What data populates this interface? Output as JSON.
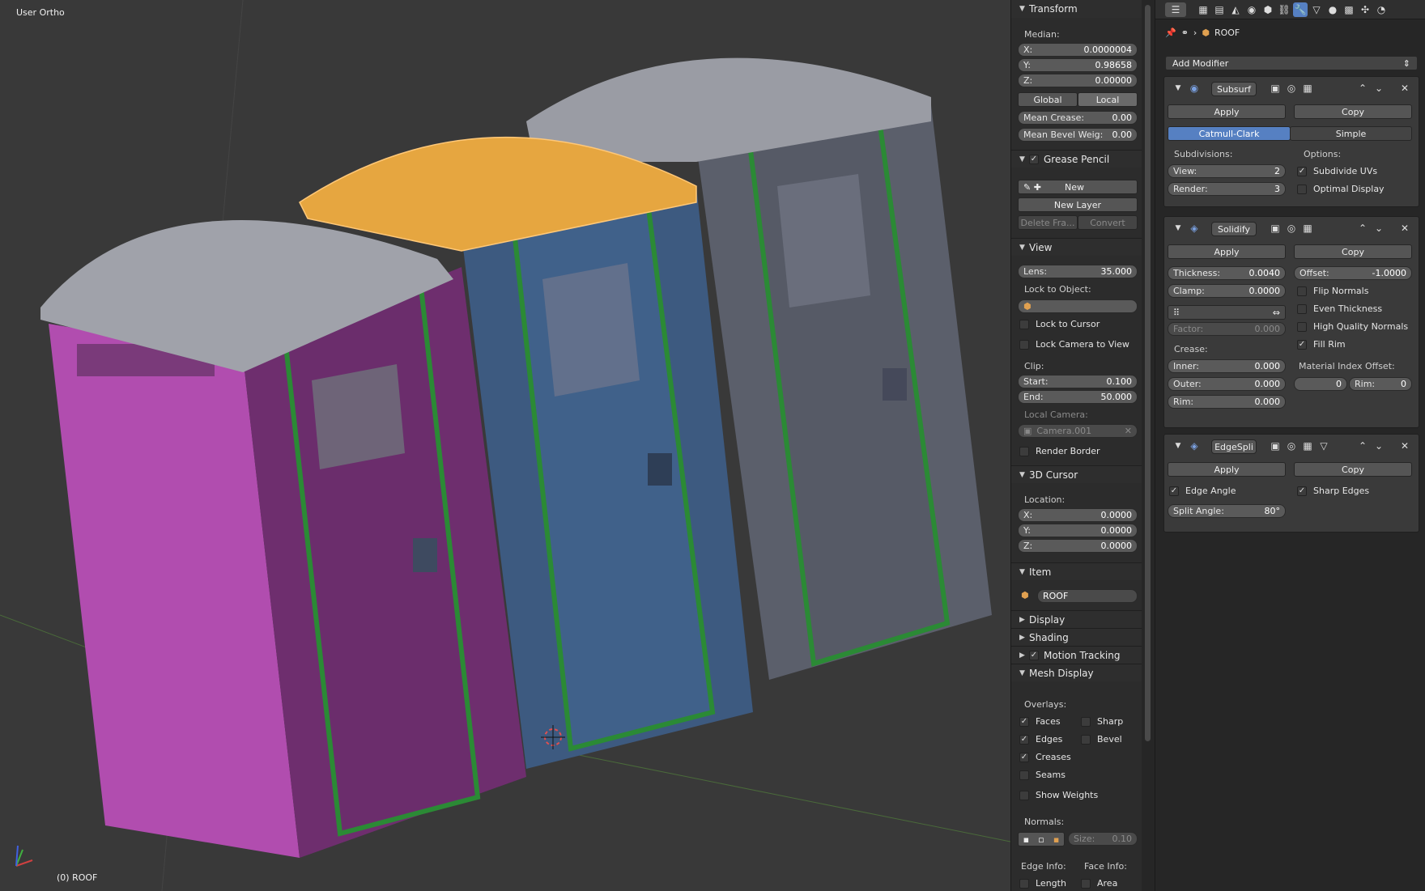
{
  "viewport": {
    "title": "User Ortho",
    "active_object": "(0) ROOF"
  },
  "npanel": {
    "transform": {
      "header": "Transform",
      "median_label": "Median:",
      "x": {
        "label": "X:",
        "value": "0.0000004"
      },
      "y": {
        "label": "Y:",
        "value": "0.98658"
      },
      "z": {
        "label": "Z:",
        "value": "0.00000"
      },
      "global_label": "Global",
      "local_label": "Local",
      "mean_crease": {
        "label": "Mean Crease:",
        "value": "0.00"
      },
      "mean_bevel": {
        "label": "Mean Bevel Weig:",
        "value": "0.00"
      }
    },
    "grease_pencil": {
      "header": "Grease Pencil",
      "new_label": "New",
      "new_layer_label": "New Layer",
      "delete_frame_label": "Delete Fra...",
      "convert_label": "Convert"
    },
    "view": {
      "header": "View",
      "lens": {
        "label": "Lens:",
        "value": "35.000"
      },
      "lock_to_object_label": "Lock to Object:",
      "lock_to_cursor_label": "Lock to Cursor",
      "lock_camera_label": "Lock Camera to View",
      "clip_label": "Clip:",
      "start": {
        "label": "Start:",
        "value": "0.100"
      },
      "end": {
        "label": "End:",
        "value": "50.000"
      },
      "local_camera_label": "Local Camera:",
      "local_camera_value": "Camera.001",
      "render_border_label": "Render Border"
    },
    "cursor": {
      "header": "3D Cursor",
      "location_label": "Location:",
      "x": {
        "label": "X:",
        "value": "0.0000"
      },
      "y": {
        "label": "Y:",
        "value": "0.0000"
      },
      "z": {
        "label": "Z:",
        "value": "0.0000"
      }
    },
    "item": {
      "header": "Item",
      "name": "ROOF"
    },
    "collapsed": {
      "display": "Display",
      "shading": "Shading",
      "motion_tracking": "Motion Tracking"
    },
    "mesh_display": {
      "header": "Mesh Display",
      "overlays_label": "Overlays:",
      "faces": "Faces",
      "sharp": "Sharp",
      "edges": "Edges",
      "bevel": "Bevel",
      "creases": "Creases",
      "seams": "Seams",
      "show_weights": "Show Weights",
      "normals_label": "Normals:",
      "size": {
        "label": "Size:",
        "value": "0.10"
      },
      "edge_info_label": "Edge Info:",
      "face_info_label": "Face Info:",
      "length": "Length",
      "area": "Area"
    }
  },
  "properties": {
    "object_name": "ROOF",
    "add_modifier_label": "Add Modifier",
    "subsurf": {
      "name": "Subsurf",
      "apply": "Apply",
      "copy": "Copy",
      "catmull": "Catmull-Clark",
      "simple": "Simple",
      "subdivisions_label": "Subdivisions:",
      "options_label": "Options:",
      "view": {
        "label": "View:",
        "value": "2"
      },
      "render": {
        "label": "Render:",
        "value": "3"
      },
      "subdivide_uvs": "Subdivide UVs",
      "optimal_display": "Optimal Display"
    },
    "solidify": {
      "name": "Solidify",
      "apply": "Apply",
      "copy": "Copy",
      "thickness": {
        "label": "Thickness:",
        "value": "0.0040"
      },
      "offset": {
        "label": "Offset:",
        "value": "-1.0000"
      },
      "clamp": {
        "label": "Clamp:",
        "value": "0.0000"
      },
      "flip_normals": "Flip Normals",
      "even_thickness": "Even Thickness",
      "high_quality_normals": "High Quality Normals",
      "fill_rim": "Fill Rim",
      "factor": {
        "label": "Factor:",
        "value": "0.000"
      },
      "crease_label": "Crease:",
      "inner": {
        "label": "Inner:",
        "value": "0.000"
      },
      "outer": {
        "label": "Outer:",
        "value": "0.000"
      },
      "rim": {
        "label": "Rim:",
        "value": "0.000"
      },
      "material_index_label": "Material Index Offset:",
      "mat_index_value": "0",
      "mat_rim": {
        "label": "Rim:",
        "value": "0"
      }
    },
    "edgesplit": {
      "name": "EdgeSpli",
      "apply": "Apply",
      "copy": "Copy",
      "edge_angle": "Edge Angle",
      "sharp_edges": "Sharp Edges",
      "split_angle": {
        "label": "Split Angle:",
        "value": "80°"
      }
    }
  },
  "colors": {
    "accent": "#5680c2",
    "selection": "#e8a040",
    "pink": "#b24db0",
    "blue": "#3f5f88",
    "grey": "#5a5f6a"
  }
}
